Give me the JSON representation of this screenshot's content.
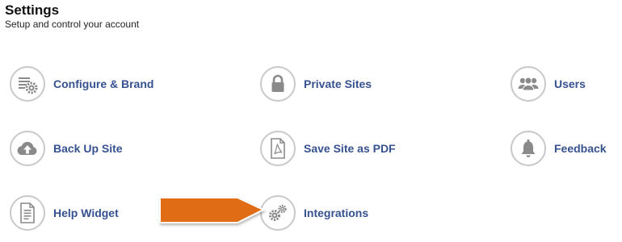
{
  "header": {
    "title": "Settings",
    "subtitle": "Setup and control your account"
  },
  "tiles": [
    {
      "label": "Configure & Brand",
      "icon": "configure-gear-icon"
    },
    {
      "label": "Private Sites",
      "icon": "lock-icon"
    },
    {
      "label": "Users",
      "icon": "users-icon"
    },
    {
      "label": "Back Up Site",
      "icon": "cloud-upload-icon"
    },
    {
      "label": "Save Site as PDF",
      "icon": "pdf-document-icon"
    },
    {
      "label": "Feedback",
      "icon": "bell-icon"
    },
    {
      "label": "Help Widget",
      "icon": "document-icon"
    },
    {
      "label": "Integrations",
      "icon": "gears-icon"
    }
  ],
  "colors": {
    "label": "#35518f",
    "icon": "#8a8a8a",
    "icon_border": "#c9c9c9",
    "callout_arrow": "#e06c14"
  }
}
